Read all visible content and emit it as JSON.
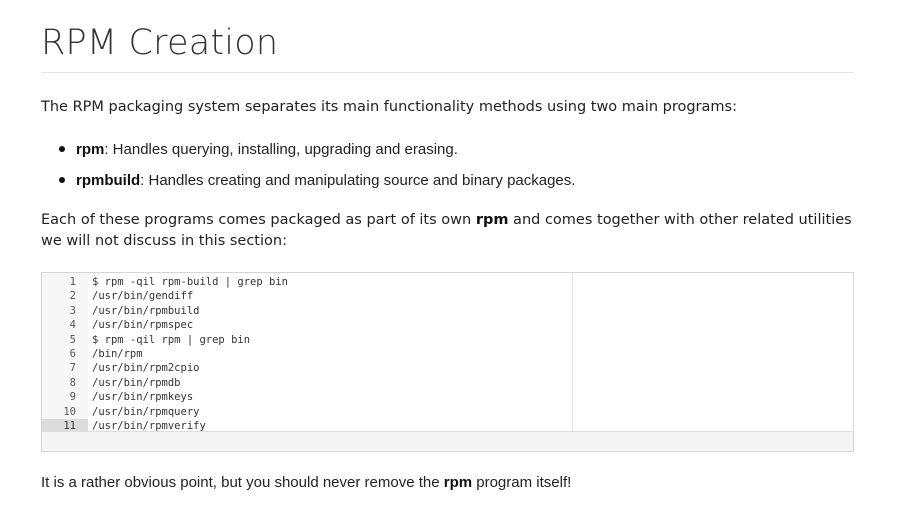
{
  "title": "RPM Creation",
  "intro": "The RPM packaging system separates its main functionality methods using two main programs:",
  "bullets": [
    {
      "term": "rpm",
      "desc": ": Handles querying, installing, upgrading and erasing."
    },
    {
      "term": "rpmbuild",
      "desc": ": Handles creating and manipulating source and binary packages."
    }
  ],
  "para2": {
    "before": "Each of these programs comes packaged as part of its own ",
    "bold": "rpm",
    "after": " and comes together with other related utilities we will not discuss in this section:"
  },
  "code": {
    "active_line": 11,
    "lines": [
      {
        "n": "1",
        "text": "$ rpm -qil rpm-build | grep bin"
      },
      {
        "n": "2",
        "text": "/usr/bin/gendiff"
      },
      {
        "n": "3",
        "text": "/usr/bin/rpmbuild"
      },
      {
        "n": "4",
        "text": "/usr/bin/rpmspec"
      },
      {
        "n": "5",
        "text": "$ rpm -qil rpm | grep bin"
      },
      {
        "n": "6",
        "text": "/bin/rpm"
      },
      {
        "n": "7",
        "text": "/usr/bin/rpm2cpio"
      },
      {
        "n": "8",
        "text": "/usr/bin/rpmdb"
      },
      {
        "n": "9",
        "text": "/usr/bin/rpmkeys"
      },
      {
        "n": "10",
        "text": "/usr/bin/rpmquery"
      },
      {
        "n": "11",
        "text": "/usr/bin/rpmverify"
      }
    ]
  },
  "para3": {
    "before": "It is a rather obvious point, but you should never remove the ",
    "bold": "rpm",
    "after": " program itself!"
  }
}
